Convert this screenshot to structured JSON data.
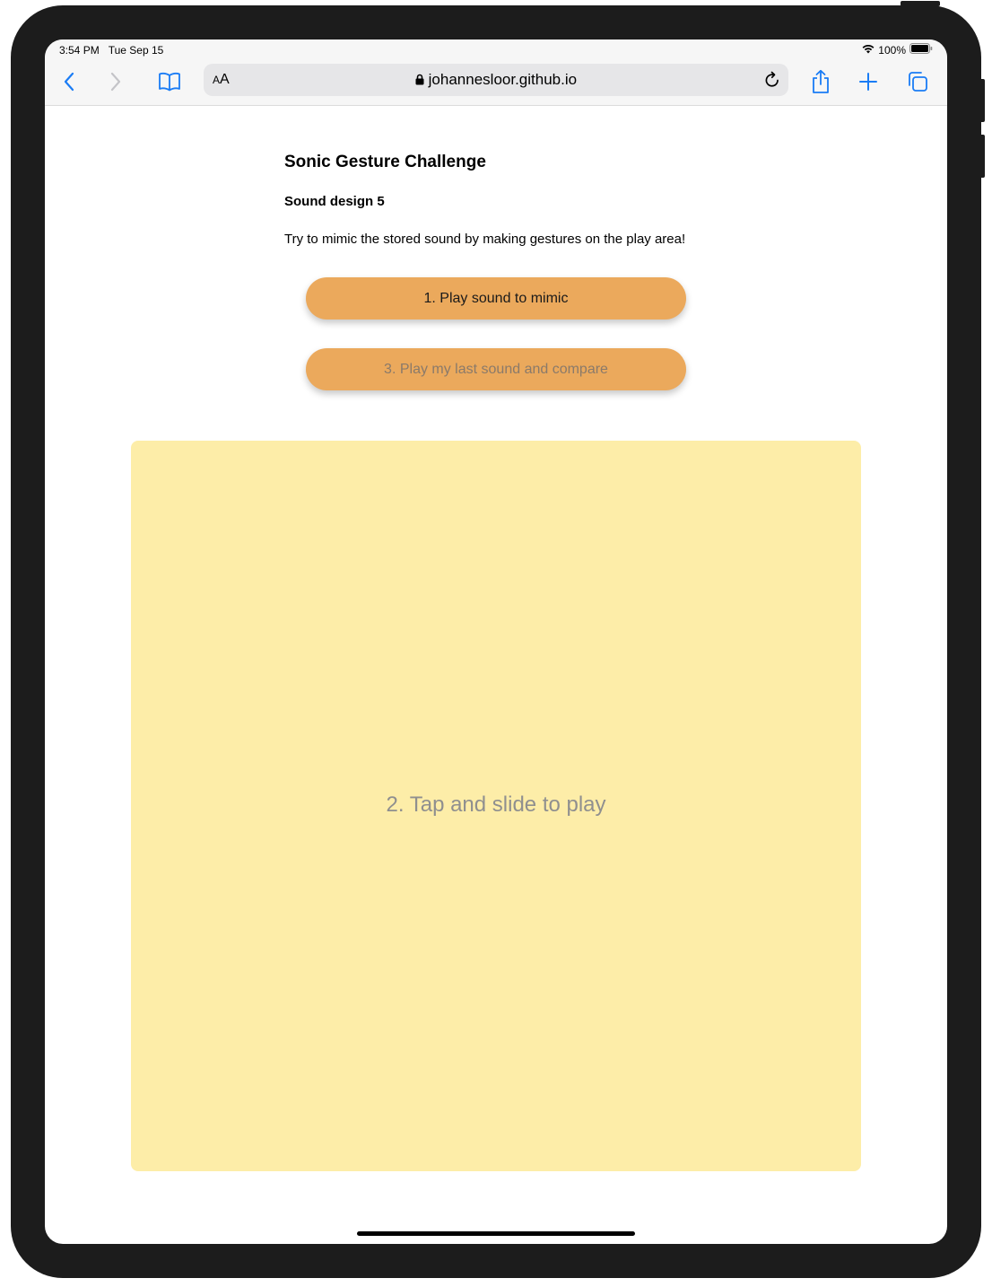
{
  "status_bar": {
    "time": "3:54 PM",
    "date": "Tue Sep 15",
    "battery": "100%"
  },
  "toolbar": {
    "text_size_label": "AA",
    "url": "johannesloor.github.io"
  },
  "page": {
    "title": "Sonic Gesture Challenge",
    "subtitle": "Sound design 5",
    "instructions": "Try to mimic the stored sound by making gestures on the play area!",
    "play_sound_button": "1. Play sound to mimic",
    "play_last_button": "3. Play my last sound and compare",
    "play_area_label": "2. Tap and slide to play"
  },
  "colors": {
    "button": "#eba95c",
    "play_area": "#fdeda8",
    "accent": "#1a7cf5"
  }
}
